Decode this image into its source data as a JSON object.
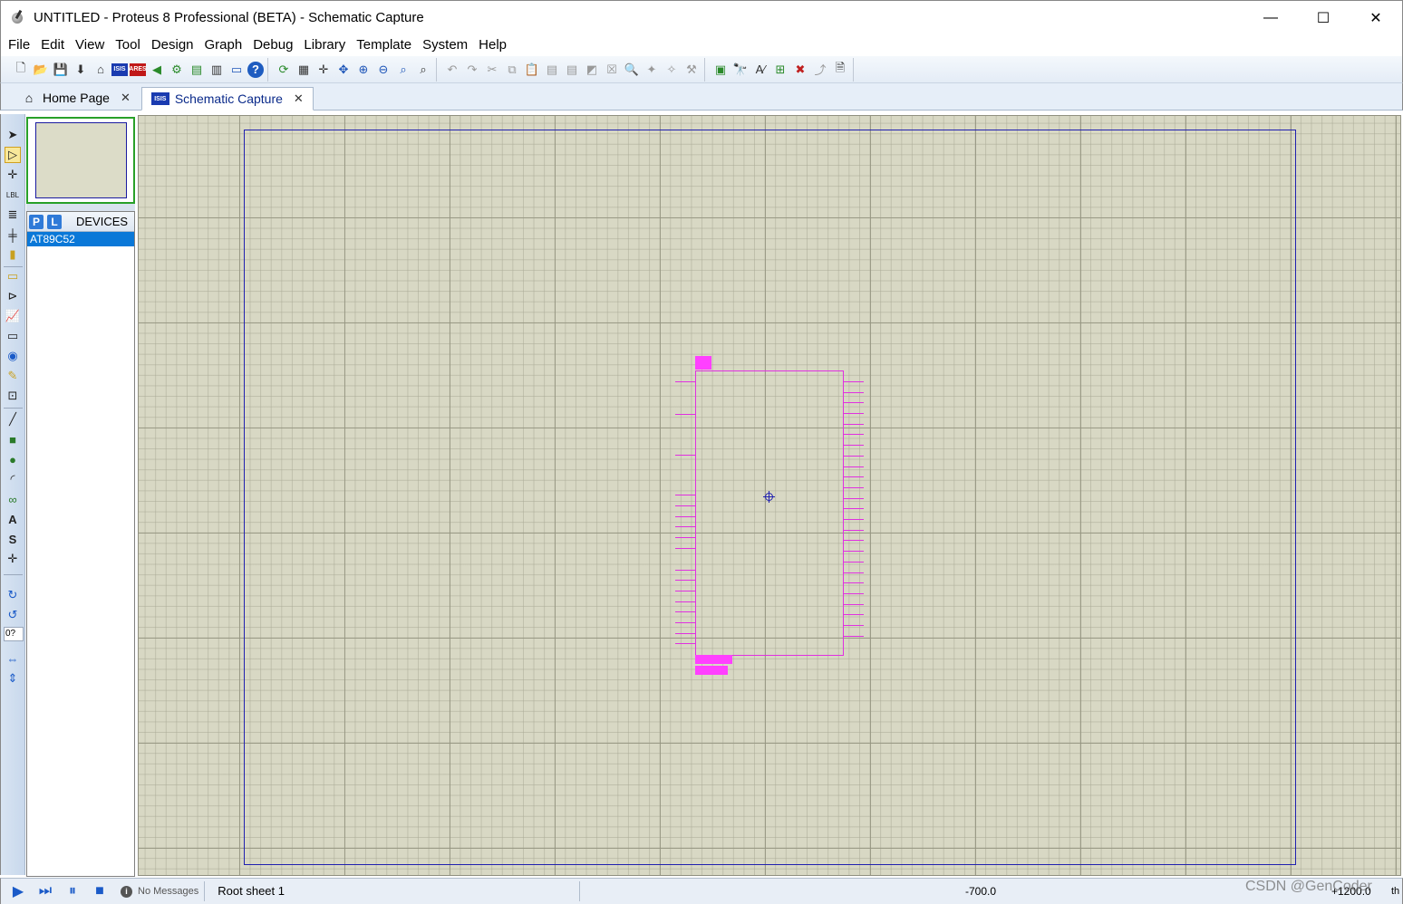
{
  "window": {
    "title": "UNTITLED - Proteus 8 Professional (BETA) - Schematic Capture",
    "minimize": "—",
    "maximize": "☐",
    "close": "✕"
  },
  "menu": [
    "File",
    "Edit",
    "View",
    "Tool",
    "Design",
    "Graph",
    "Debug",
    "Library",
    "Template",
    "System",
    "Help"
  ],
  "tabs": [
    {
      "label": "Home Page",
      "active": false
    },
    {
      "label": "Schematic Capture",
      "active": true
    }
  ],
  "device_panel": {
    "p_button": "P",
    "l_button": "L",
    "header": "DEVICES",
    "devices": [
      "AT89C52"
    ],
    "selected": "AT89C52"
  },
  "toolstrip": {
    "rotation_value": "0?"
  },
  "statusbar": {
    "messages": "No Messages",
    "sheet": "Root sheet 1",
    "x_coord": "-700.0",
    "y_coord": "+1200.0",
    "units": "th"
  },
  "watermark": "CSDN @GenCoder",
  "colors": {
    "canvas": "#d8d8c4",
    "sheet_border": "#2020b0",
    "component": "#e030e0",
    "selection": "#0a78d8"
  }
}
